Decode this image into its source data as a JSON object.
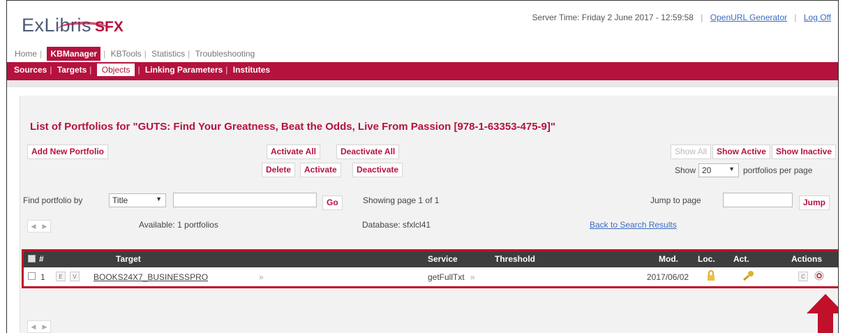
{
  "header": {
    "logo_main": "ExLibris",
    "logo_sub": "SFX",
    "server_time": "Server Time: Friday 2 June 2017 - 12:59:58",
    "links": [
      "OpenURL Generator",
      "Log Off"
    ]
  },
  "top_nav": {
    "items": [
      "Home",
      "KBManager",
      "KBTools",
      "Statistics",
      "Troubleshooting"
    ],
    "active": "KBManager"
  },
  "sub_nav": {
    "items": [
      "Sources",
      "Targets",
      "Objects",
      "Linking Parameters",
      "Institutes"
    ],
    "active": "Objects"
  },
  "main": {
    "title": "List of Portfolios for \"GUTS: Find Your Greatness, Beat the Odds, Live From Passion [978-1-63353-475-9]\"",
    "buttons": {
      "add_new": "Add New Portfolio",
      "activate_all": "Activate All",
      "deactivate_all": "Deactivate All",
      "delete": "Delete",
      "activate": "Activate",
      "deactivate": "Deactivate",
      "show_all": "Show All",
      "show_active": "Show Active",
      "show_inactive": "Show Inactive",
      "go": "Go",
      "jump": "Jump"
    },
    "per_page": {
      "prefix": "Show",
      "value": "20",
      "suffix": "portfolios per page"
    },
    "find": {
      "label": "Find portfolio by",
      "field": "Title",
      "value": ""
    },
    "showing_page": "Showing page 1 of 1",
    "jump_label": "Jump to page",
    "jump_value": "",
    "available": "Available: 1 portfolios",
    "database": "Database: sfxlcl41",
    "back_link": "Back to Search Results"
  },
  "table": {
    "headers": {
      "num": "#",
      "target": "Target",
      "service": "Service",
      "threshold": "Threshold",
      "mod": "Mod.",
      "loc": "Loc.",
      "act": "Act.",
      "actions": "Actions"
    },
    "rows": [
      {
        "num": "1",
        "e": "E",
        "v": "V",
        "target": "BOOKS24X7_BUSINESSPRO",
        "service": "getFullTxt",
        "threshold": "",
        "mod": "2017/06/02",
        "action_c": "C"
      }
    ]
  },
  "colors": {
    "brand": "#b5123e",
    "highlight_box": "#c0102a",
    "link": "#3a6cc0",
    "table_header": "#3e3e3e"
  }
}
